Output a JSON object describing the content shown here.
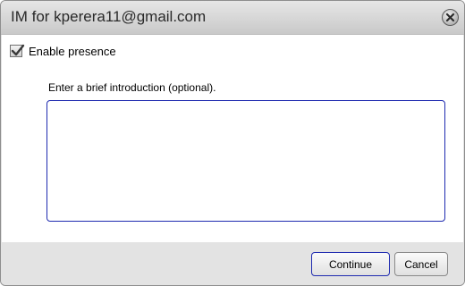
{
  "dialog": {
    "title": "IM for kperera11@gmail.com",
    "close_icon": "close-icon"
  },
  "presence": {
    "label": "Enable presence",
    "checked": true
  },
  "introduction": {
    "label": "Enter a brief introduction (optional).",
    "value": "",
    "placeholder": ""
  },
  "buttons": {
    "continue_label": "Continue",
    "cancel_label": "Cancel"
  },
  "colors": {
    "accent_border": "#1f2bb0",
    "footer_bg": "#e3e3e3",
    "titlebar_bg": "#d6d6d6"
  }
}
